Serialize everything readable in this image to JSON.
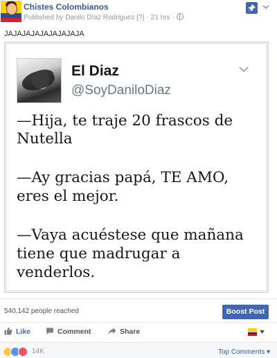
{
  "post": {
    "page_name": "Chistes Colombianos",
    "publisher_prefix": "Published by",
    "publisher_name": "Danilo Díaz Rodriguez",
    "publisher_marker": "[?]",
    "separator": "·",
    "time": "21 hrs",
    "status_text": "JAJAJAJAJAJAJAJAJA"
  },
  "tweet": {
    "name": "El Diaz",
    "handle": "@SoyDaniloDiaz",
    "lines": [
      "—Hija, te traje 20 frascos de",
      "Nutella",
      "—Ay gracias papá, TE AMO,",
      "eres el mejor.",
      "—Vaya acuéstese que mañana",
      "tiene que madrugar a",
      "venderlos."
    ]
  },
  "insights": {
    "reach_text": "540,142 people reached",
    "boost_label": "Boost Post"
  },
  "actions": {
    "like_label": "Like",
    "comment_label": "Comment",
    "share_label": "Share"
  },
  "reactions": {
    "types": [
      "haha",
      "like",
      "love"
    ],
    "count": "14K",
    "top_comments_label": "Top Comments ▾"
  },
  "colors": {
    "link_blue": "#365899",
    "brand_blue": "#4267b2",
    "flag_yellow": "#fcd116",
    "flag_blue": "#003893",
    "flag_red": "#ce1126"
  }
}
